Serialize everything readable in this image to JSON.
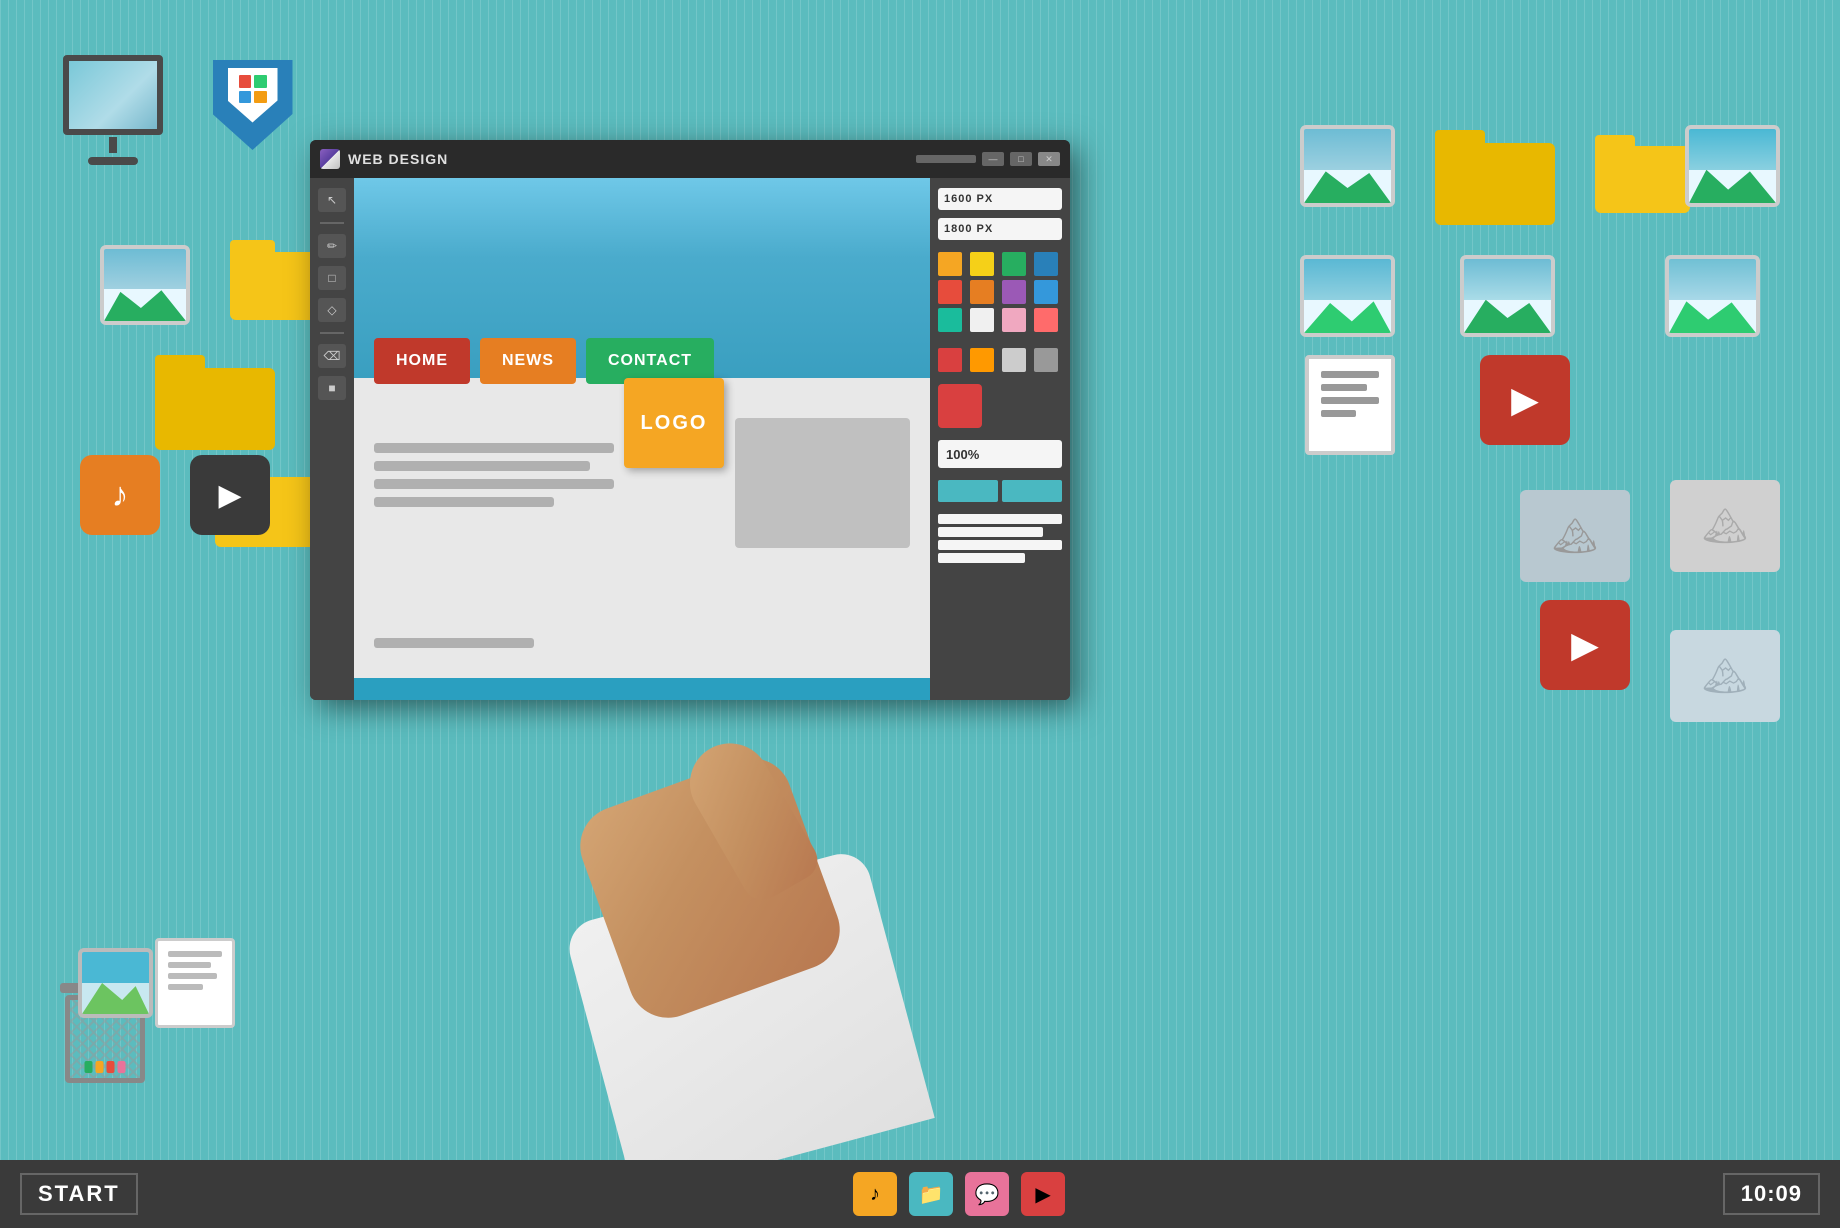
{
  "taskbar": {
    "start_label": "START",
    "time": "10:09",
    "icons": [
      {
        "name": "music",
        "color": "#f5a623",
        "symbol": "♪"
      },
      {
        "name": "folder",
        "color": "#4ab8c1",
        "symbol": "📁"
      },
      {
        "name": "chat",
        "color": "#e8739a",
        "symbol": "💬"
      },
      {
        "name": "play",
        "color": "#d94040",
        "symbol": "▶"
      }
    ]
  },
  "window": {
    "title": "WEB DESIGN",
    "controls": {
      "minimize": "—",
      "maximize": "□",
      "close": "✕"
    },
    "right_panel": {
      "field1": "1600 PX",
      "field2": "1800 PX",
      "zoom": "100%",
      "colors": [
        "#f5a623",
        "#f5c518",
        "#27ae60",
        "#2980b9",
        "#e74c3c",
        "#e67e22",
        "#9b59b6",
        "#3498db",
        "#1abc9c",
        "#f0f0f0",
        "#f5a0c0",
        "#ff6b6b",
        "#d94040",
        "#ff9900",
        "#cccccc",
        "#999999"
      ]
    },
    "canvas": {
      "nav_items": [
        {
          "label": "HOME",
          "color": "#c0392b"
        },
        {
          "label": "NEWS",
          "color": "#e67e22"
        },
        {
          "label": "CONTACT",
          "color": "#27ae60"
        }
      ],
      "logo_label": "LOGO"
    }
  },
  "desktop": {
    "background_color": "#5bbcbe"
  }
}
